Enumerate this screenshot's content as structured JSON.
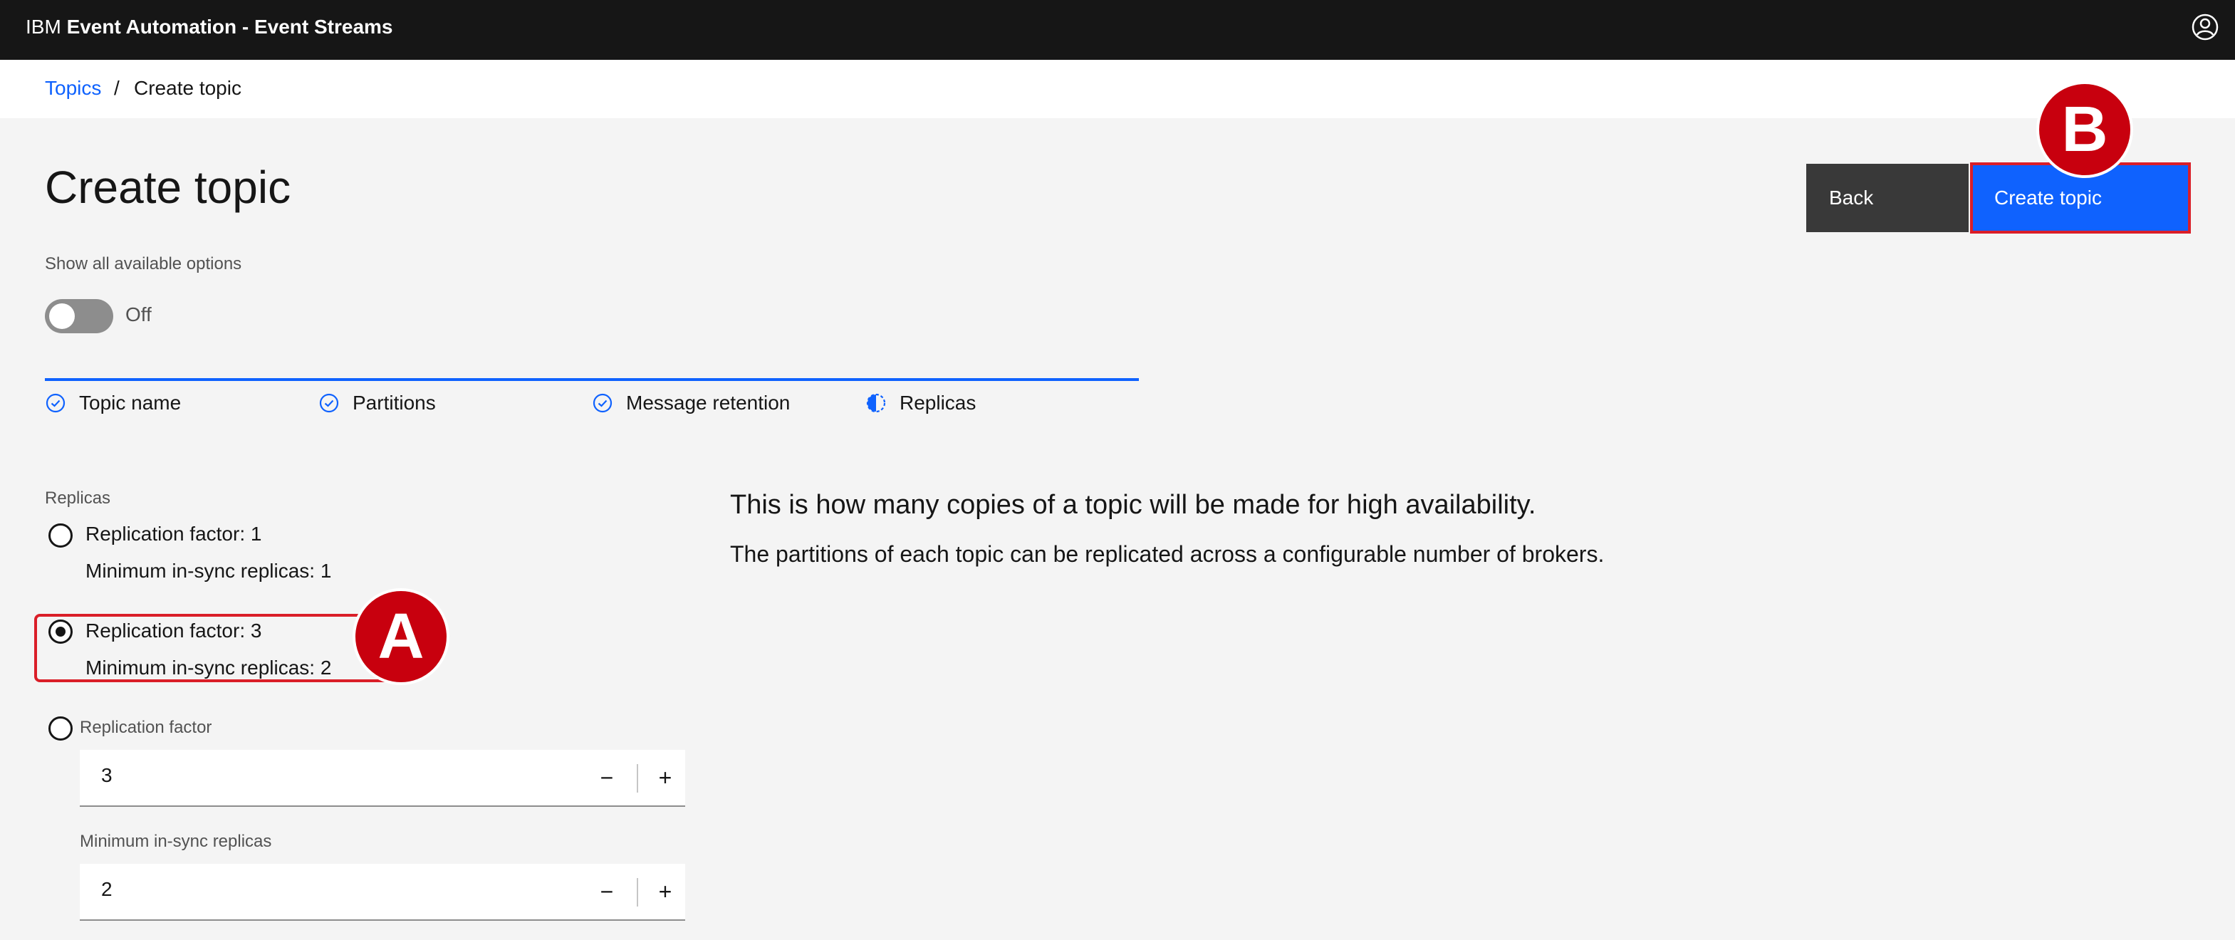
{
  "header": {
    "brand_prefix": "IBM",
    "product": "Event Automation - Event Streams"
  },
  "breadcrumb": {
    "link": "Topics",
    "separator": "/",
    "current": "Create topic"
  },
  "page": {
    "title": "Create topic"
  },
  "actions": {
    "back": "Back",
    "create": "Create topic"
  },
  "toggle": {
    "label": "Show all available options",
    "state": "Off"
  },
  "steps": [
    {
      "label": "Topic name",
      "status": "complete"
    },
    {
      "label": "Partitions",
      "status": "complete"
    },
    {
      "label": "Message retention",
      "status": "complete"
    },
    {
      "label": "Replicas",
      "status": "current"
    }
  ],
  "replicas": {
    "section_label": "Replicas",
    "options": [
      {
        "line1": "Replication factor: 1",
        "line2": "Minimum in-sync replicas: 1",
        "selected": false
      },
      {
        "line1": "Replication factor: 3",
        "line2": "Minimum in-sync replicas: 2",
        "selected": true
      }
    ],
    "custom": {
      "label": "Replication factor",
      "factor_value": "3",
      "min_label": "Minimum in-sync replicas",
      "min_value": "2",
      "minus": "−",
      "plus": "+"
    }
  },
  "description": {
    "heading": "This is how many copies of a topic will be made for high availability.",
    "body": "The partitions of each topic can be replicated across a configurable number of brokers."
  },
  "markers": {
    "a": "A",
    "b": "B"
  },
  "colors": {
    "primary": "#0f62fe",
    "marker": "#c8000e",
    "header": "#161616"
  },
  "icons": {
    "user": "user-avatar-icon",
    "complete": "checkmark-outline-icon",
    "current": "incomplete-icon"
  }
}
